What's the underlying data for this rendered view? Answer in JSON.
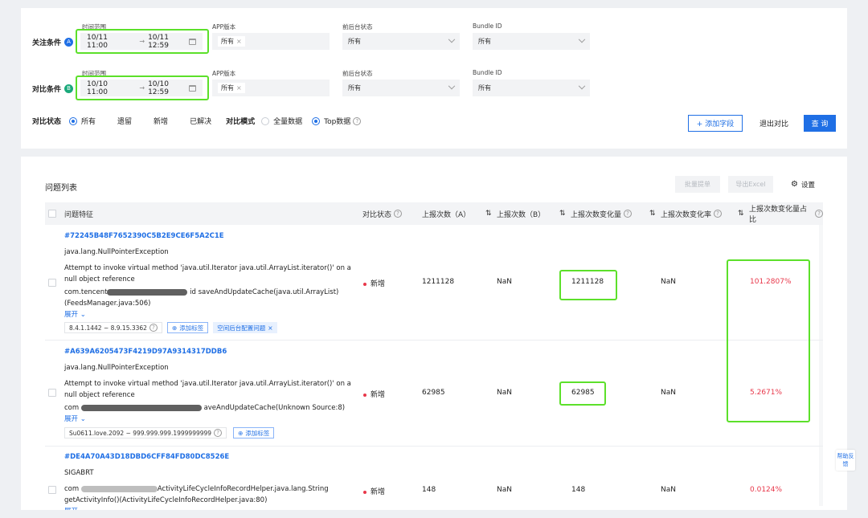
{
  "filters": {
    "focus_label": "关注条件",
    "focus_badge": "A",
    "compare_label": "对比条件",
    "compare_badge": "B",
    "time_label": "时间范围",
    "app_label": "APP版本",
    "fgbg_label": "前后台状态",
    "bundle_label": "Bundle ID",
    "focus_start": "10/11 11:00",
    "focus_end": "10/11 12:59",
    "compare_start": "10/10 11:00",
    "compare_end": "10/10 12:59",
    "arrow": "→",
    "all_chip": "所有",
    "chip_x": "×",
    "all_value": "所有",
    "compare_status_label": "对比状态",
    "status_options": [
      "所有",
      "遗留",
      "新增",
      "已解决"
    ],
    "compare_mode_label": "对比模式",
    "mode_options": [
      "全量数据",
      "Top数据"
    ],
    "add_field": "+ 添加字段",
    "exit_compare": "退出对比",
    "query": "查 询"
  },
  "list": {
    "title": "问题列表",
    "batch_button": "批量提单",
    "export_button": "导出Excel",
    "settings_button": "设置",
    "columns": [
      "问题特征",
      "对比状态",
      "上报次数（A）",
      "上报次数（B）",
      "上报次数变化量",
      "上报次数变化率",
      "上报次数变化量占比"
    ],
    "rows": [
      {
        "id": "#72245B48F7652390C5B2E9CE6F5A2C1E",
        "type": "java.lang.NullPointerException",
        "msg1": "Attempt to invoke virtual method 'java.util.Iterator java.util.ArrayList.iterator()' on a null object reference",
        "msg2_start": "com.tencent",
        "msg2_end": "id saveAndUpdateCache(java.util.ArrayList)",
        "msg3": "(FeedsManager.java:506)",
        "expand": "展开",
        "version": "8.4.1.1442 ~ 8.9.15.3362",
        "add_tag": "添加标签",
        "extra_tag": "空间后台配置问题",
        "status": "新增",
        "count_a": "1211128",
        "count_b": "NaN",
        "delta": "1211128",
        "rate": "NaN",
        "share": "101.2807%"
      },
      {
        "id": "#A639A6205473F4219D97A9314317DDB6",
        "type": "java.lang.NullPointerException",
        "msg1": "Attempt to invoke virtual method 'java.util.Iterator java.util.ArrayList.iterator()' on a null object reference",
        "msg2_start": "com",
        "msg2_end": "aveAndUpdateCache(Unknown Source:8)",
        "expand": "展开",
        "version": "Su0611.love.2092 ~ 999.999.999.1999999999",
        "add_tag": "添加标签",
        "status": "新增",
        "count_a": "62985",
        "count_b": "NaN",
        "delta": "62985",
        "rate": "NaN",
        "share": "5.2671%"
      },
      {
        "id": "#DE4A70A43D18DBD6CFF84FD80DC8526E",
        "type": "SIGABRT",
        "msg1_start": "com",
        "msg1_end": "ActivityLifeCycleInfoRecordHelper.java.lang.String",
        "msg2": "getActivityInfo()(ActivityLifeCycleInfoRecordHelper.java:80)",
        "expand": "展开",
        "status": "新增",
        "count_a": "148",
        "count_b": "NaN",
        "delta": "148",
        "rate": "NaN",
        "share": "0.0124%"
      }
    ]
  },
  "help": "帮助反馈",
  "colors": {
    "accent": "#1f6fe5",
    "highlight": "#5ce02a",
    "danger": "#e8374a",
    "badge_a": "#1f6fe5",
    "badge_b": "#1aa97b"
  }
}
